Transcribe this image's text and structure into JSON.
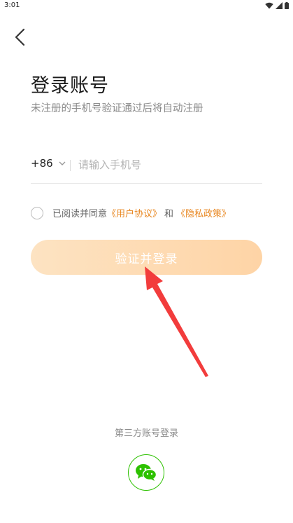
{
  "status": {
    "time": "3:01",
    "icons": [
      "wifi-icon",
      "signal-icon",
      "battery-icon"
    ]
  },
  "nav": {
    "back_icon": "chevron-left-icon"
  },
  "header": {
    "title": "登录账号",
    "subtitle": "未注册的手机号验证通过后将自动注册"
  },
  "phone": {
    "country_code": "+86",
    "placeholder": "请输入手机号",
    "value": ""
  },
  "agreement": {
    "prefix": "已阅读并同意",
    "user_agreement": "《用户协议》",
    "and": "和",
    "privacy_policy": "《隐私政策》",
    "checked": false
  },
  "login_button": {
    "label": "验证并登录"
  },
  "third_party": {
    "label": "第三方账号登录",
    "wechat_icon": "wechat-icon"
  },
  "colors": {
    "accent": "#e8861f",
    "button_start": "#fde3c2",
    "button_end": "#fed4a6",
    "wechat": "#2dc100",
    "arrow": "#f23c3c"
  }
}
